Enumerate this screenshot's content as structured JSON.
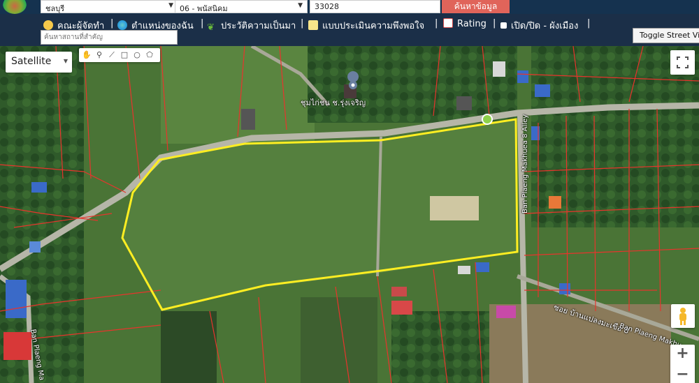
{
  "header": {
    "province": "ชลบุรี",
    "district": "06 - พนัสนิคม",
    "code": "33028",
    "search_button": "ค้นหาข้อมูล"
  },
  "nav": {
    "items": [
      {
        "label": "คณะผู้จัดทำ",
        "icon": "people-icon",
        "color": "#f5c84a"
      },
      {
        "label": "ตำแหน่งของฉัน",
        "icon": "globe-icon",
        "color": "#2d9de0"
      },
      {
        "label": "ประวัติความเป็นมา",
        "icon": "sprout-icon",
        "color": "#6cbf3a"
      },
      {
        "label": "แบบประเมินความพึงพอใจ",
        "icon": "form-icon",
        "color": "#f7e58a"
      },
      {
        "label": "Rating",
        "icon": "chart-icon",
        "color": "#d24a4a"
      },
      {
        "label": "เปิด/ปิด - ผังเมือง",
        "icon": "checkbox-icon",
        "color": "#ffffff"
      }
    ],
    "place_search_placeholder": "ค้นหาสถานที่สำคัญ",
    "street_view_button": "Toggle Street View"
  },
  "map": {
    "type_selector": "Satellite",
    "labels": {
      "poi": "ชุมไก่ชน ช.รุ่งเจริญ",
      "road_vertical": "Ban Plaeng Makhuea 8 Alley",
      "road_thai": "ซอย บ้านแปลงมะเขือ 8",
      "road_bottom_right": "Ban Plaeng Makhu",
      "road_bottom_left": "Ban Plaeng Ma"
    },
    "colors": {
      "parcel_lines": "#e8342c",
      "highlight": "#ffee22",
      "field": "#4f7a3c"
    },
    "zoom_in": "+",
    "zoom_out": "−"
  }
}
